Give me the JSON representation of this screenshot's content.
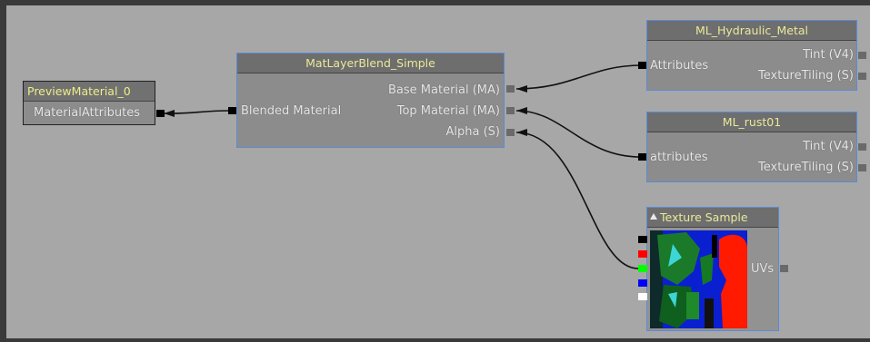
{
  "nodes": {
    "preview_material": {
      "title": "PreviewMaterial_0",
      "inputs": [
        "MaterialAttributes"
      ]
    },
    "mat_layer_blend": {
      "title": "MatLayerBlend_Simple",
      "inputs": [
        "Blended Material"
      ],
      "outputs": [
        "Base Material (MA)",
        "Top Material (MA)",
        "Alpha (S)"
      ]
    },
    "ml_hydraulic_metal": {
      "title": "ML_Hydraulic_Metal",
      "inputs": [
        "Attributes"
      ],
      "outputs": [
        "Tint (V4)",
        "TextureTiling (S)"
      ]
    },
    "ml_rust01": {
      "title": "ML_rust01",
      "inputs": [
        "attributes"
      ],
      "outputs": [
        "Tint (V4)",
        "TextureTiling (S)"
      ]
    },
    "texture_sample": {
      "title": "Texture Sample",
      "outputs": [
        "UVs"
      ],
      "channel_colors": [
        "#000000",
        "#ff0000",
        "#00ff00",
        "#0000ff",
        "#ffffff"
      ]
    }
  },
  "colors": {
    "canvas": "#a7a7a7",
    "node_body": "#8c8c8c",
    "node_title": "#6e6e6e",
    "selected_border": "#5a8bd9",
    "title_text": "#e9e99a"
  }
}
